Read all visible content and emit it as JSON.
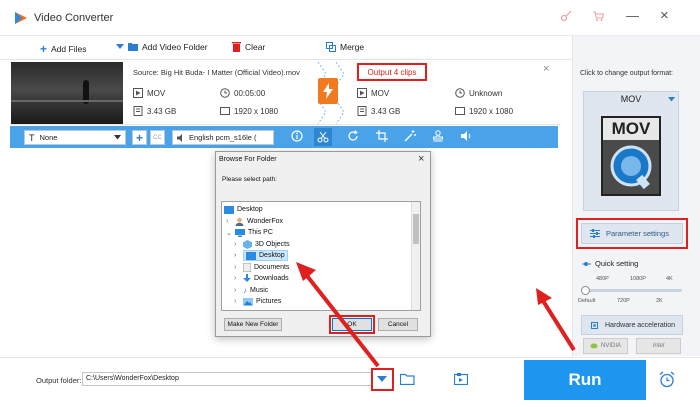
{
  "app": {
    "title": "Video Converter"
  },
  "toolbar": {
    "add_files": "Add Files",
    "add_video_folder": "Add Video Folder",
    "clear": "Clear",
    "merge": "Merge"
  },
  "file": {
    "source_label": "Source: Big Hit Buda- I Matter (Official Video).mov",
    "output_label": "Output 4 clips",
    "source": {
      "format": "MOV",
      "duration": "00:05:00",
      "size": "3.43 GB",
      "resolution": "1920 x 1080"
    },
    "output": {
      "format": "MOV",
      "duration": "Unknown",
      "size": "3.43 GB",
      "resolution": "1920 x 1080"
    }
  },
  "edit_bar": {
    "subtitle": "None",
    "audio": "English pcm_s16le ("
  },
  "right_panel": {
    "hint": "Click to change output format:",
    "format": "MOV",
    "format_icon_text": "MOV",
    "parameter_settings": "Parameter settings",
    "quick_setting": "Quick setting",
    "ticks_top": [
      "480P",
      "1080P",
      "4K"
    ],
    "ticks_bottom": [
      "Default",
      "720P",
      "2K"
    ],
    "hardware_acceleration": "Hardware acceleration",
    "nvidia": "NVIDIA",
    "intel": "Intel"
  },
  "bottom": {
    "output_folder_label": "Output folder:",
    "output_path": "C:\\Users\\WonderFox\\Desktop",
    "run": "Run"
  },
  "dialog": {
    "title": "Browse For Folder",
    "prompt": "Please select path:",
    "tree": [
      "Desktop",
      "WonderFox",
      "This PC",
      "3D Objects",
      "Desktop",
      "Documents",
      "Downloads",
      "Music",
      "Pictures"
    ],
    "make_new_folder": "Make New Folder",
    "ok": "OK",
    "cancel": "Cancel"
  },
  "colors": {
    "accent": "#2196f3",
    "toolbar_blue": "#4aa3e8",
    "annotation_red": "#e0201e"
  }
}
